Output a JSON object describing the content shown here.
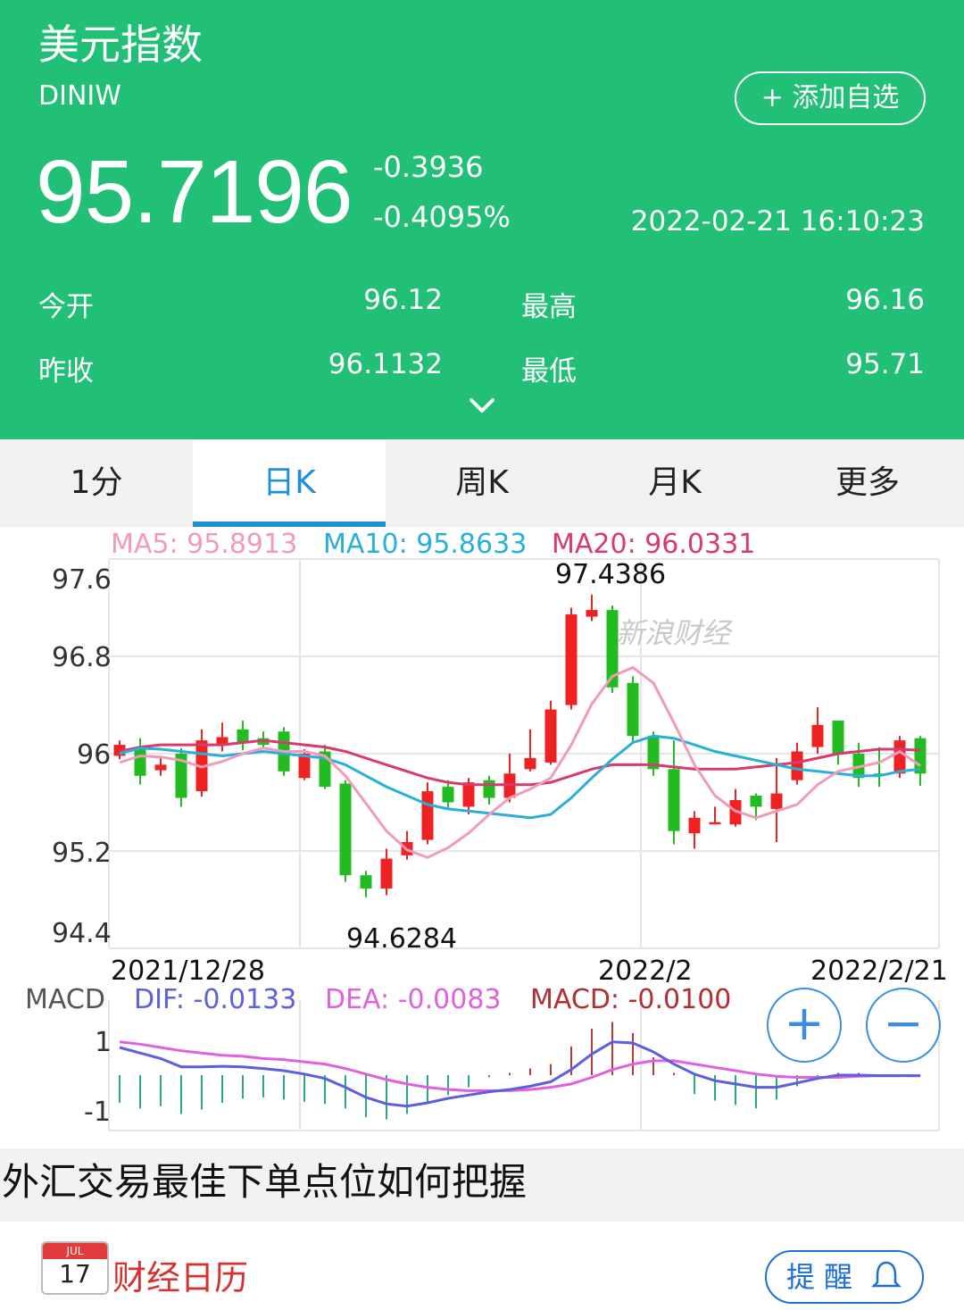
{
  "header": {
    "title": "美元指数",
    "code": "DINIW",
    "add_button": "+ 添加自选",
    "price": "95.7196",
    "change": "-0.3936",
    "change_pct": "-0.4095%",
    "timestamp": "2022-02-21 16:10:23",
    "stats": {
      "open_label": "今开",
      "open_value": "96.12",
      "high_label": "最高",
      "high_value": "96.16",
      "prev_close_label": "昨收",
      "prev_close_value": "96.1132",
      "low_label": "最低",
      "low_value": "95.71"
    },
    "expand_icon": "chevron-down-icon"
  },
  "colors": {
    "header_bg": "#22bf77",
    "accent": "#1e90d8",
    "up": "#ee2222",
    "down": "#22bb22",
    "ma5": "#f29bb8",
    "ma10": "#2ab0d8",
    "ma20": "#d63a6e",
    "dif": "#5a60e0",
    "dea": "#e060e0",
    "macd_label": "#b03030"
  },
  "tabs": [
    {
      "label": "1分",
      "active": false
    },
    {
      "label": "日K",
      "active": true
    },
    {
      "label": "周K",
      "active": false
    },
    {
      "label": "月K",
      "active": false
    },
    {
      "label": "更多",
      "active": false
    }
  ],
  "ma_legend": {
    "ma5": "MA5: 95.8913",
    "ma10": "MA10: 95.8633",
    "ma20": "MA20: 96.0331"
  },
  "chart_data": {
    "type": "candlestick",
    "y_ticks": [
      "97.6",
      "96.8",
      "96",
      "95.2",
      "94.4"
    ],
    "ylim": [
      94.4,
      97.6
    ],
    "x_labels": [
      "2021/12/28",
      "2022/2",
      "2022/2/21"
    ],
    "max_label": "97.4386",
    "min_label": "94.6284",
    "watermark": "新浪财经",
    "candles": [
      {
        "o": 95.98,
        "c": 96.08,
        "h": 96.12,
        "l": 95.95
      },
      {
        "o": 96.05,
        "c": 95.8,
        "h": 96.14,
        "l": 95.72
      },
      {
        "o": 95.85,
        "c": 95.9,
        "h": 95.98,
        "l": 95.8
      },
      {
        "o": 96.0,
        "c": 95.6,
        "h": 96.05,
        "l": 95.52
      },
      {
        "o": 95.66,
        "c": 96.12,
        "h": 96.22,
        "l": 95.61
      },
      {
        "o": 96.08,
        "c": 96.15,
        "h": 96.28,
        "l": 96.02
      },
      {
        "o": 96.22,
        "c": 96.1,
        "h": 96.3,
        "l": 96.03
      },
      {
        "o": 96.14,
        "c": 96.08,
        "h": 96.2,
        "l": 96.04
      },
      {
        "o": 96.2,
        "c": 95.84,
        "h": 96.24,
        "l": 95.8
      },
      {
        "o": 95.78,
        "c": 96.0,
        "h": 96.04,
        "l": 95.76
      },
      {
        "o": 96.02,
        "c": 95.7,
        "h": 96.08,
        "l": 95.68
      },
      {
        "o": 95.73,
        "c": 94.9,
        "h": 95.76,
        "l": 94.84
      },
      {
        "o": 94.9,
        "c": 94.78,
        "h": 94.94,
        "l": 94.7
      },
      {
        "o": 94.78,
        "c": 95.05,
        "h": 95.14,
        "l": 94.72
      },
      {
        "o": 95.08,
        "c": 95.2,
        "h": 95.3,
        "l": 95.04
      },
      {
        "o": 95.22,
        "c": 95.66,
        "h": 95.74,
        "l": 95.18
      },
      {
        "o": 95.7,
        "c": 95.56,
        "h": 95.76,
        "l": 95.5
      },
      {
        "o": 95.52,
        "c": 95.74,
        "h": 95.78,
        "l": 95.45
      },
      {
        "o": 95.76,
        "c": 95.6,
        "h": 95.8,
        "l": 95.54
      },
      {
        "o": 95.6,
        "c": 95.82,
        "h": 96.0,
        "l": 95.56
      },
      {
        "o": 95.86,
        "c": 95.96,
        "h": 96.22,
        "l": 95.84
      },
      {
        "o": 95.92,
        "c": 96.4,
        "h": 96.48,
        "l": 95.9
      },
      {
        "o": 96.44,
        "c": 97.26,
        "h": 97.32,
        "l": 96.4
      },
      {
        "o": 97.24,
        "c": 97.3,
        "h": 97.44,
        "l": 97.2
      },
      {
        "o": 97.3,
        "c": 96.6,
        "h": 97.34,
        "l": 96.55
      },
      {
        "o": 96.64,
        "c": 96.16,
        "h": 96.7,
        "l": 96.1
      },
      {
        "o": 96.16,
        "c": 95.86,
        "h": 96.2,
        "l": 95.8
      },
      {
        "o": 95.86,
        "c": 95.3,
        "h": 96.12,
        "l": 95.18
      },
      {
        "o": 95.28,
        "c": 95.42,
        "h": 95.48,
        "l": 95.14
      },
      {
        "o": 95.36,
        "c": 95.38,
        "h": 95.52,
        "l": 95.36
      },
      {
        "o": 95.36,
        "c": 95.58,
        "h": 95.68,
        "l": 95.34
      },
      {
        "o": 95.62,
        "c": 95.52,
        "h": 95.64,
        "l": 95.4
      },
      {
        "o": 95.5,
        "c": 95.64,
        "h": 95.96,
        "l": 95.2
      },
      {
        "o": 95.76,
        "c": 96.02,
        "h": 96.1,
        "l": 95.72
      },
      {
        "o": 96.06,
        "c": 96.26,
        "h": 96.42,
        "l": 96.0
      },
      {
        "o": 96.3,
        "c": 96.0,
        "h": 96.3,
        "l": 95.9
      },
      {
        "o": 96.0,
        "c": 95.78,
        "h": 96.1,
        "l": 95.7
      },
      {
        "o": 95.82,
        "c": 95.8,
        "h": 96.06,
        "l": 95.7
      },
      {
        "o": 95.82,
        "c": 96.12,
        "h": 96.16,
        "l": 95.78
      },
      {
        "o": 96.14,
        "c": 95.82,
        "h": 96.16,
        "l": 95.71
      }
    ],
    "ma5": [
      95.92,
      95.98,
      95.97,
      95.94,
      95.88,
      95.93,
      96.0,
      96.05,
      96.02,
      96.02,
      95.98,
      95.8,
      95.55,
      95.3,
      95.13,
      95.06,
      95.15,
      95.28,
      95.45,
      95.6,
      95.68,
      95.78,
      96.08,
      96.45,
      96.7,
      96.78,
      96.64,
      96.28,
      95.9,
      95.62,
      95.48,
      95.42,
      95.48,
      95.54,
      95.72,
      95.84,
      95.88,
      95.92,
      96.02,
      95.89
    ],
    "ma10": [
      96.0,
      96.05,
      96.04,
      96.02,
      96.0,
      95.98,
      96.0,
      96.02,
      96.0,
      95.98,
      95.96,
      95.9,
      95.8,
      95.7,
      95.62,
      95.54,
      95.5,
      95.48,
      95.46,
      95.44,
      95.42,
      95.45,
      95.6,
      95.78,
      95.95,
      96.1,
      96.16,
      96.14,
      96.08,
      96.02,
      95.98,
      95.94,
      95.9,
      95.86,
      95.84,
      95.82,
      95.8,
      95.8,
      95.84,
      95.86
    ],
    "ma20": [
      96.02,
      96.06,
      96.08,
      96.08,
      96.08,
      96.08,
      96.1,
      96.12,
      96.1,
      96.08,
      96.06,
      96.02,
      95.96,
      95.9,
      95.84,
      95.78,
      95.74,
      95.72,
      95.72,
      95.72,
      95.72,
      95.74,
      95.8,
      95.86,
      95.9,
      95.9,
      95.9,
      95.88,
      95.86,
      95.86,
      95.86,
      95.88,
      95.9,
      95.92,
      95.96,
      96.0,
      96.02,
      96.04,
      96.04,
      96.03
    ]
  },
  "macd": {
    "title": "MACD",
    "dif_label": "DIF: -0.0133",
    "dea_label": "DEA: -0.0083",
    "macd_label": "MACD: -0.0100",
    "y_ticks": [
      "1",
      "-1"
    ],
    "zoom_in": "+",
    "zoom_out": "−",
    "dif": [
      0.5,
      0.4,
      0.3,
      0.15,
      0.15,
      0.16,
      0.15,
      0.12,
      0.08,
      0.02,
      -0.06,
      -0.22,
      -0.4,
      -0.52,
      -0.56,
      -0.5,
      -0.42,
      -0.36,
      -0.3,
      -0.26,
      -0.2,
      -0.12,
      0.1,
      0.38,
      0.6,
      0.58,
      0.42,
      0.2,
      0.02,
      -0.1,
      -0.16,
      -0.22,
      -0.22,
      -0.14,
      -0.06,
      0.0,
      0.0,
      -0.01,
      -0.01,
      -0.013
    ],
    "dea": [
      0.6,
      0.56,
      0.5,
      0.44,
      0.4,
      0.36,
      0.34,
      0.3,
      0.28,
      0.24,
      0.2,
      0.12,
      0.02,
      -0.08,
      -0.16,
      -0.22,
      -0.26,
      -0.28,
      -0.28,
      -0.28,
      -0.26,
      -0.22,
      -0.16,
      -0.04,
      0.1,
      0.2,
      0.26,
      0.26,
      0.2,
      0.14,
      0.08,
      0.02,
      -0.02,
      -0.04,
      -0.04,
      -0.04,
      -0.02,
      -0.01,
      -0.01,
      -0.008
    ],
    "hist": [
      -0.5,
      -0.6,
      -0.56,
      -0.7,
      -0.62,
      -0.5,
      -0.42,
      -0.4,
      -0.44,
      -0.48,
      -0.52,
      -0.6,
      -0.76,
      -0.8,
      -0.7,
      -0.5,
      -0.36,
      -0.22,
      -0.04,
      0.04,
      0.12,
      0.2,
      0.52,
      0.84,
      0.96,
      0.76,
      0.32,
      0.04,
      -0.34,
      -0.46,
      -0.54,
      -0.6,
      -0.44,
      -0.2,
      -0.04,
      0.04,
      0.04,
      0.0,
      0.0,
      -0.01
    ]
  },
  "article": {
    "title": "外汇交易最佳下单点位如何把握"
  },
  "calendar": {
    "month": "JUL",
    "day": "17",
    "label": "财经日历",
    "remind_button": "提 醒"
  }
}
